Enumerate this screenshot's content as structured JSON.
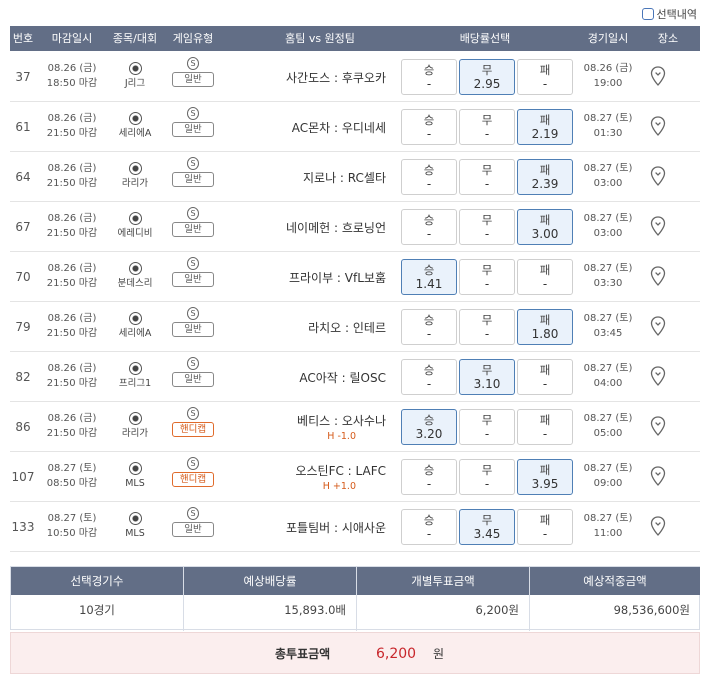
{
  "toggle": {
    "label": "선택내역"
  },
  "header": [
    "번호",
    "마감일시",
    "종목/대회",
    "게임유형",
    "홈팀 vs 원정팀",
    "배당률선택",
    "경기일시",
    "장소"
  ],
  "games": [
    {
      "no": "37",
      "deadline_date": "08.26 (금)",
      "deadline_time": "18:50 마감",
      "league": "J리그",
      "game_type": "일반",
      "handicap": "",
      "teams": "사간도스 : 후쿠오카",
      "win_label": "승",
      "win_odds": "-",
      "draw_label": "무",
      "draw_odds": "2.95",
      "lose_label": "패",
      "lose_odds": "-",
      "selected": "draw",
      "game_date": "08.26 (금)",
      "game_time": "19:00"
    },
    {
      "no": "61",
      "deadline_date": "08.26 (금)",
      "deadline_time": "21:50 마감",
      "league": "세리에A",
      "game_type": "일반",
      "handicap": "",
      "teams": "AC몬차 : 우디네세",
      "win_label": "승",
      "win_odds": "-",
      "draw_label": "무",
      "draw_odds": "-",
      "lose_label": "패",
      "lose_odds": "2.19",
      "selected": "lose",
      "game_date": "08.27 (토)",
      "game_time": "01:30"
    },
    {
      "no": "64",
      "deadline_date": "08.26 (금)",
      "deadline_time": "21:50 마감",
      "league": "라리가",
      "game_type": "일반",
      "handicap": "",
      "teams": "지로나 : RC셀타",
      "win_label": "승",
      "win_odds": "-",
      "draw_label": "무",
      "draw_odds": "-",
      "lose_label": "패",
      "lose_odds": "2.39",
      "selected": "lose",
      "game_date": "08.27 (토)",
      "game_time": "03:00"
    },
    {
      "no": "67",
      "deadline_date": "08.26 (금)",
      "deadline_time": "21:50 마감",
      "league": "에레디비",
      "game_type": "일반",
      "handicap": "",
      "teams": "네이메헌 : 흐로닝언",
      "win_label": "승",
      "win_odds": "-",
      "draw_label": "무",
      "draw_odds": "-",
      "lose_label": "패",
      "lose_odds": "3.00",
      "selected": "lose",
      "game_date": "08.27 (토)",
      "game_time": "03:00"
    },
    {
      "no": "70",
      "deadline_date": "08.26 (금)",
      "deadline_time": "21:50 마감",
      "league": "분데스리",
      "game_type": "일반",
      "handicap": "",
      "teams": "프라이부 : VfL보훔",
      "win_label": "승",
      "win_odds": "1.41",
      "draw_label": "무",
      "draw_odds": "-",
      "lose_label": "패",
      "lose_odds": "-",
      "selected": "win",
      "game_date": "08.27 (토)",
      "game_time": "03:30"
    },
    {
      "no": "79",
      "deadline_date": "08.26 (금)",
      "deadline_time": "21:50 마감",
      "league": "세리에A",
      "game_type": "일반",
      "handicap": "",
      "teams": "라치오 : 인테르",
      "win_label": "승",
      "win_odds": "-",
      "draw_label": "무",
      "draw_odds": "-",
      "lose_label": "패",
      "lose_odds": "1.80",
      "selected": "lose",
      "game_date": "08.27 (토)",
      "game_time": "03:45"
    },
    {
      "no": "82",
      "deadline_date": "08.26 (금)",
      "deadline_time": "21:50 마감",
      "league": "프리그1",
      "game_type": "일반",
      "handicap": "",
      "teams": "AC아작 : 릴OSC",
      "win_label": "승",
      "win_odds": "-",
      "draw_label": "무",
      "draw_odds": "3.10",
      "lose_label": "패",
      "lose_odds": "-",
      "selected": "draw",
      "game_date": "08.27 (토)",
      "game_time": "04:00"
    },
    {
      "no": "86",
      "deadline_date": "08.26 (금)",
      "deadline_time": "21:50 마감",
      "league": "라리가",
      "game_type": "핸디캡",
      "handicap": "H -1.0",
      "teams": "베티스 : 오사수나",
      "win_label": "승",
      "win_odds": "3.20",
      "draw_label": "무",
      "draw_odds": "-",
      "lose_label": "패",
      "lose_odds": "-",
      "selected": "win",
      "game_date": "08.27 (토)",
      "game_time": "05:00"
    },
    {
      "no": "107",
      "deadline_date": "08.27 (토)",
      "deadline_time": "08:50 마감",
      "league": "MLS",
      "game_type": "핸디캡",
      "handicap": "H +1.0",
      "teams": "오스틴FC : LAFC",
      "win_label": "승",
      "win_odds": "-",
      "draw_label": "무",
      "draw_odds": "-",
      "lose_label": "패",
      "lose_odds": "3.95",
      "selected": "lose",
      "game_date": "08.27 (토)",
      "game_time": "09:00"
    },
    {
      "no": "133",
      "deadline_date": "08.27 (토)",
      "deadline_time": "10:50 마감",
      "league": "MLS",
      "game_type": "일반",
      "handicap": "",
      "teams": "포틀팀버 : 시애사운",
      "win_label": "승",
      "win_odds": "-",
      "draw_label": "무",
      "draw_odds": "3.45",
      "lose_label": "패",
      "lose_odds": "-",
      "selected": "draw",
      "game_date": "08.27 (토)",
      "game_time": "11:00"
    }
  ],
  "summary": {
    "headers": [
      "선택경기수",
      "예상배당률",
      "개별투표금액",
      "예상적중금액"
    ],
    "values": [
      "10경기",
      "15,893.0배",
      "6,200원",
      "98,536,600원"
    ]
  },
  "total": {
    "label": "총투표금액",
    "value": "6,200",
    "unit": "원"
  },
  "colors": {
    "header_bg": "#626e86",
    "selected_border": "#4f7fb5",
    "selected_bg": "#eaf2fb",
    "handicap": "#d55a1a",
    "total_value": "#c8262b",
    "total_bg": "#fbeeee"
  },
  "icons": {
    "league": "soccer-ball-icon",
    "game_type": "s-circle-icon",
    "venue": "map-pin-icon"
  }
}
